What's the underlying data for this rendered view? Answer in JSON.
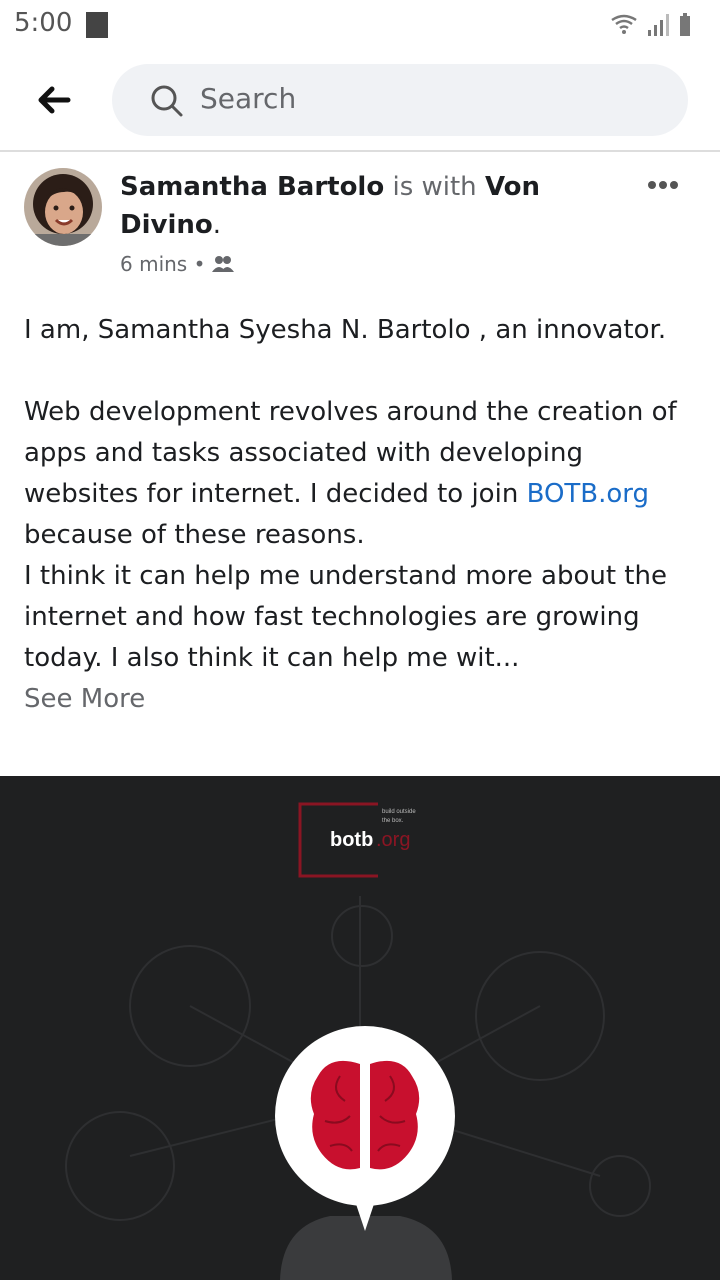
{
  "status_bar": {
    "time": "5:00"
  },
  "search": {
    "placeholder": "Search"
  },
  "post": {
    "author": "Samantha Bartolo",
    "with_text": "is with",
    "tagged": "Von Divino",
    "tagged_suffix": ".",
    "time": "6 mins",
    "privacy_icon": "friends-icon",
    "intro": "I am, Samantha Syesha N. Bartolo , an innovator.",
    "body_before_link": "Web development revolves around the creation of apps and tasks associated with developing websites for internet. I decided to join",
    "link_text": "BOTB.org",
    "body_after_link": "because of these reasons.",
    "body_2": "I think it can help me understand more about the internet and how fast technologies are growing today. I also think it can help me wit...",
    "see_more": "See More"
  },
  "image": {
    "logo_text": "botb",
    "logo_suffix": ".org",
    "tagline_1": "build outside",
    "tagline_2": "the box."
  },
  "colors": {
    "link": "#1a6cc8",
    "image_bg": "#1f2021",
    "brain": "#c8102e"
  }
}
